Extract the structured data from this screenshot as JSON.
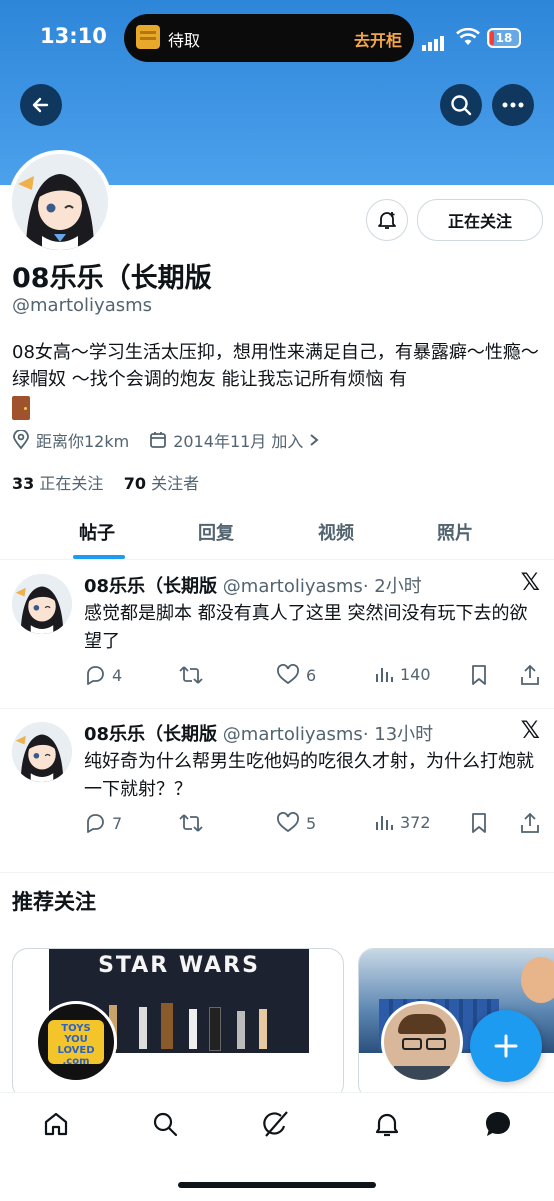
{
  "status_bar": {
    "time": "13:10",
    "island_left": "待取",
    "island_right": "去开柜",
    "battery": "18"
  },
  "profile": {
    "name": "08乐乐（长期版",
    "handle": "@martoliyasms",
    "bio": "08女高～学习生活太压抑，想用性来满足自己，有暴露癖～性瘾～绿帽奴 ～找个会调的炮友 能让我忘记所有烦恼 有",
    "location": "距离你12km",
    "joined": "2014年11月 加入",
    "following_count": "33",
    "following_label": "正在关注",
    "followers_count": "70",
    "followers_label": "关注者",
    "follow_button": "正在关注"
  },
  "tabs": [
    {
      "label": "帖子",
      "active": true
    },
    {
      "label": "回复",
      "active": false
    },
    {
      "label": "视频",
      "active": false
    },
    {
      "label": "照片",
      "active": false
    }
  ],
  "posts": [
    {
      "name": "08乐乐（长期版",
      "handle": "@martoliyasms",
      "time": "· 2小时",
      "text": "感觉都是脚本 都没有真人了这里 突然间没有玩下去的欲望了",
      "replies": "4",
      "reposts": "",
      "likes": "6",
      "views": "140"
    },
    {
      "name": "08乐乐（长期版",
      "handle": "@martoliyasms",
      "time": "· 13小时",
      "text": "纯好奇为什么帮男生吃他妈的吃很久才射，为什么打炮就一下就射？？",
      "replies": "7",
      "reposts": "",
      "likes": "5",
      "views": "372"
    }
  ],
  "recommend": {
    "title": "推荐关注",
    "card1_poster": "STAR WARS",
    "card1_logo_lines": [
      "TOYS",
      "YOU",
      "LOVED",
      ".com"
    ]
  },
  "colors": {
    "accent": "#1d9bf0",
    "banner": "#3a94e3",
    "dark_button": "#10375e"
  }
}
